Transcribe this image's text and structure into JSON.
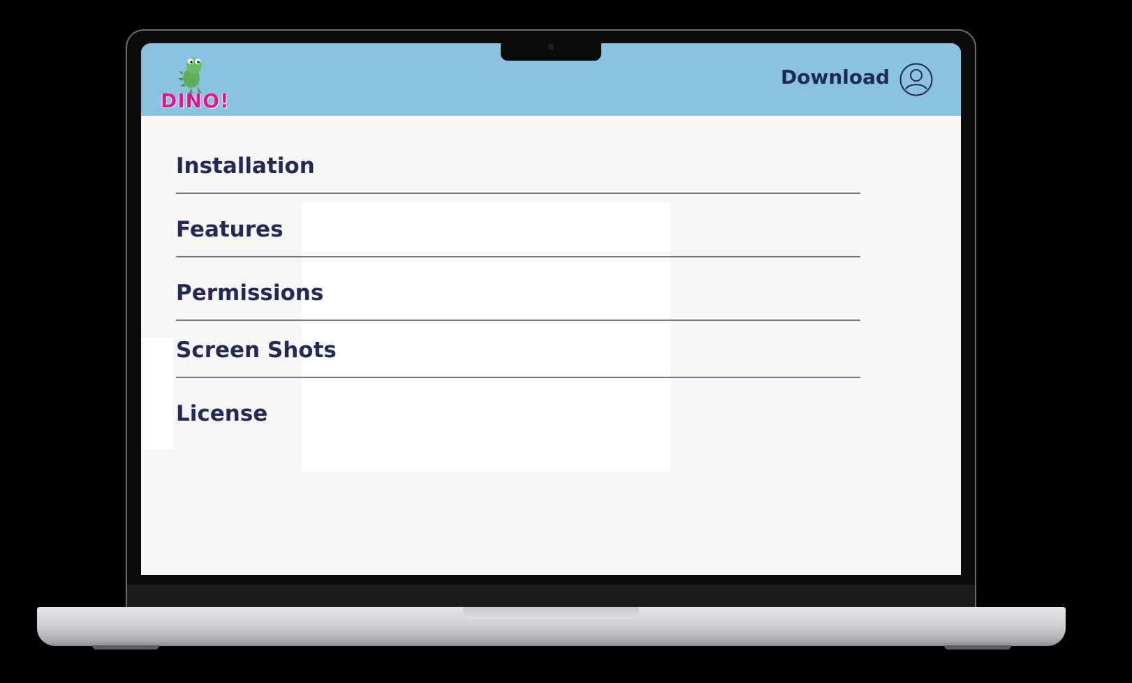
{
  "header": {
    "logo_text": "DINO!",
    "download_label": "Download",
    "account_icon": "user-circle-icon"
  },
  "menu": {
    "items": [
      {
        "label": "Installation"
      },
      {
        "label": "Features"
      },
      {
        "label": "Permissions"
      },
      {
        "label": "Screen Shots"
      },
      {
        "label": "License"
      }
    ]
  },
  "colors": {
    "header_bg": "#8ac3e1",
    "text": "#232a57",
    "logo": "#e0168f",
    "page_bg": "#f7f6f5"
  }
}
